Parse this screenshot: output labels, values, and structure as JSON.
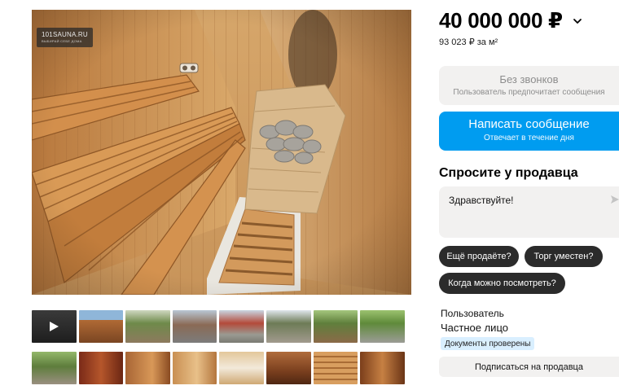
{
  "gallery": {
    "watermark": {
      "main": "101SAUNA.RU",
      "sub": "ВЫБИРАЙ СЕБЕ ДОМА"
    },
    "video_label": "video",
    "thumbnails_row1": [
      "video",
      "wooden-house",
      "yard",
      "courtyard-road",
      "gate",
      "yard-wall",
      "fence-house",
      "street-road"
    ],
    "thumbnails_row2": [
      "garden",
      "sauna-red-room",
      "wood-interior",
      "window-room",
      "jacuzzi",
      "lounge-room",
      "sauna-bench",
      "corridor"
    ]
  },
  "listing": {
    "price": "40 000 000 ₽",
    "price_per_m2": "93 023 ₽ за м²"
  },
  "contact": {
    "no_calls_title": "Без звонков",
    "no_calls_sub": "Пользователь предпочитает сообщения",
    "write_title": "Написать сообщение",
    "write_sub": "Отвечает в течение дня"
  },
  "ask": {
    "title": "Спросите у продавца",
    "message": "Здравствуйте!",
    "chips": [
      "Ещё продаёте?",
      "Торг уместен?",
      "Когда можно посмотреть?"
    ]
  },
  "seller": {
    "type": "Пользователь",
    "name": "Частное лицо",
    "badge": "Документы проверены",
    "subscribe": "Подписаться на продавца"
  },
  "colors": {
    "accent": "#009cf0",
    "chip": "#2b2b2b",
    "panel": "#f2f1f0",
    "badge": "#d9efff"
  }
}
